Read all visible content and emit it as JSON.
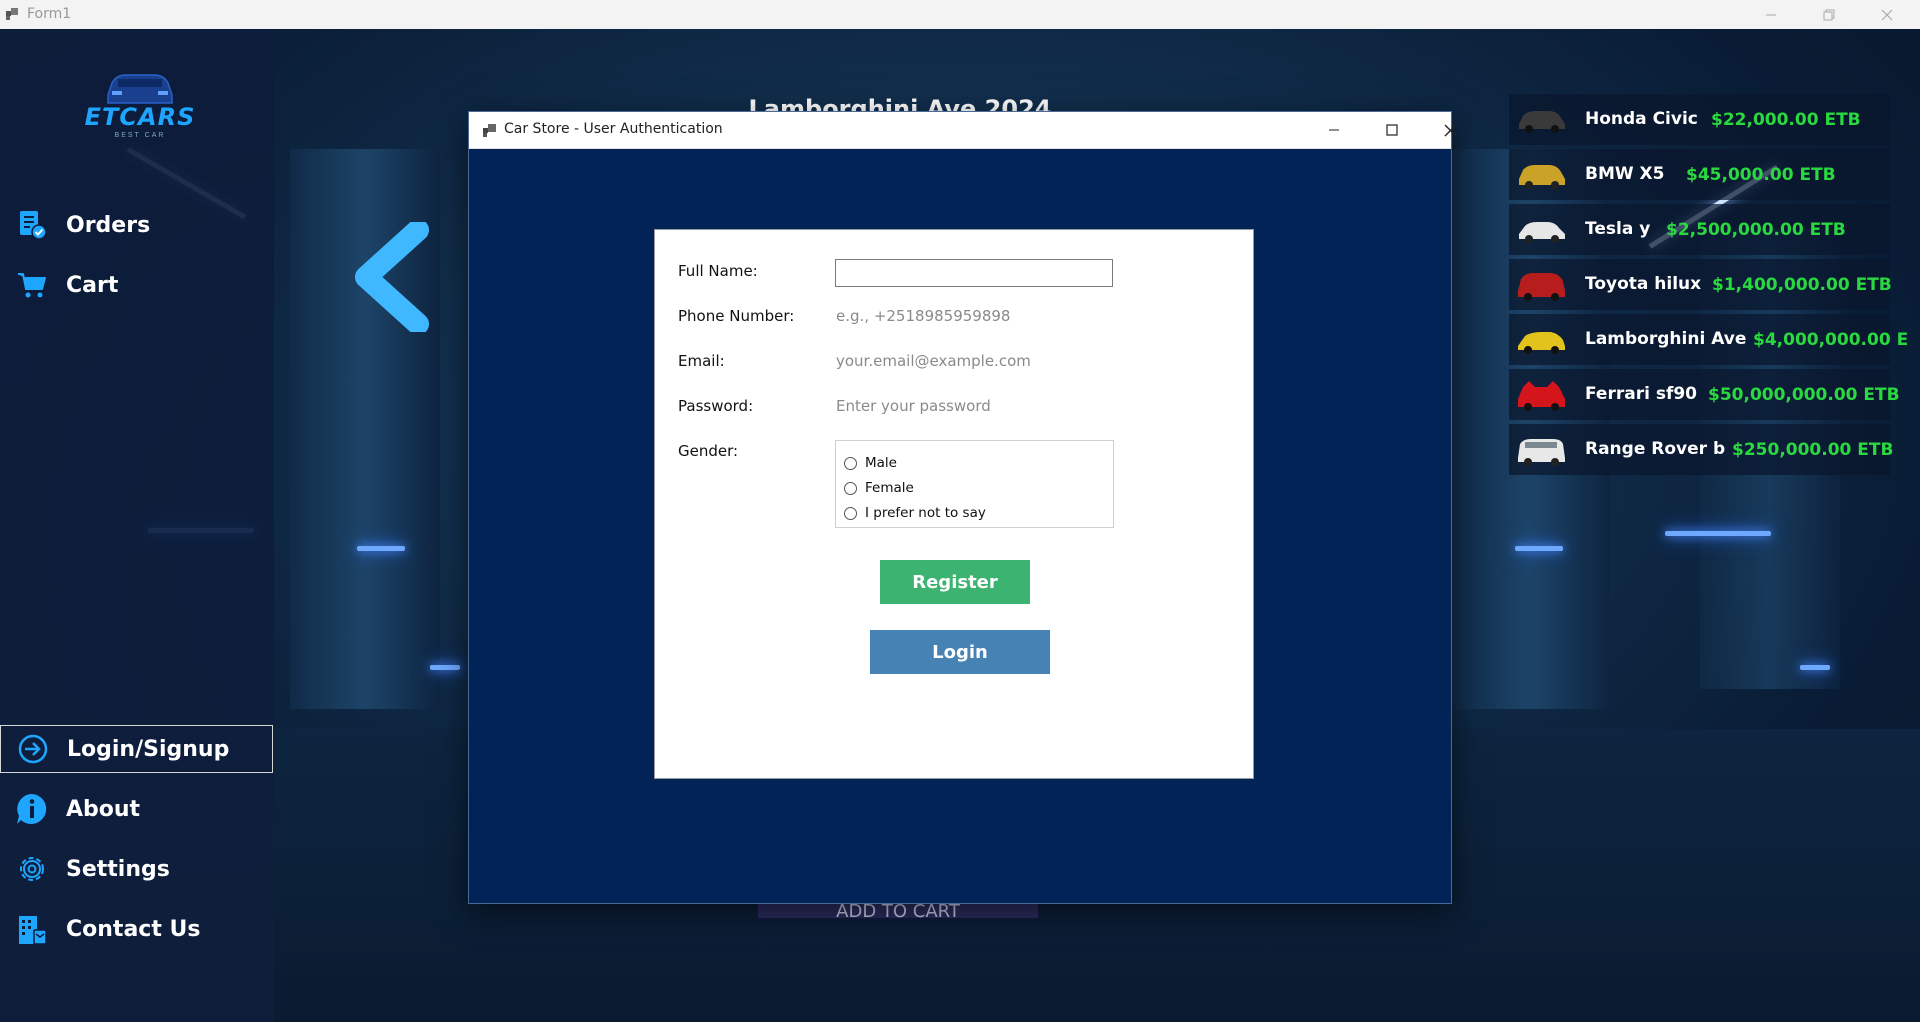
{
  "window": {
    "title": "Form1"
  },
  "sidebar": {
    "logo_text": "ETCARS",
    "logo_subtext": "BEST CAR",
    "top_items": [
      {
        "label": "Orders",
        "icon": "orders-icon"
      },
      {
        "label": "Cart",
        "icon": "cart-icon"
      }
    ],
    "bottom_items": [
      {
        "label": "Login/Signup",
        "icon": "login-icon",
        "active": true
      },
      {
        "label": "About",
        "icon": "info-icon"
      },
      {
        "label": "Settings",
        "icon": "gear-icon"
      },
      {
        "label": "Contact Us",
        "icon": "building-icon"
      }
    ]
  },
  "featured": {
    "title": "Lamborghini Ave 2024",
    "add_to_cart_label": "ADD TO CART"
  },
  "car_list": [
    {
      "name": "Honda Civic",
      "price": "$22,000.00 ETB",
      "color": "#3a3a3a"
    },
    {
      "name": "BMW X5",
      "price": "$45,000.00 ETB",
      "color": "#c9a227"
    },
    {
      "name": "Tesla y",
      "price": "$2,500,000.00 ETB",
      "color": "#e6e6e6"
    },
    {
      "name": "Toyota hilux",
      "price": "$1,400,000.00 ETB",
      "color": "#b81d1d"
    },
    {
      "name": "Lamborghini Ave",
      "price": "$4,000,000.00 E",
      "color": "#e2c21c"
    },
    {
      "name": "Ferrari sf90",
      "price": "$50,000,000.00 ETB",
      "color": "#d4161c"
    },
    {
      "name": "Range Rover b",
      "price": "$250,000.00 ETB",
      "color": "#e8e8e8"
    }
  ],
  "dialog": {
    "title": "Car Store - User Authentication",
    "fields": {
      "full_name": {
        "label": "Full Name:",
        "value": ""
      },
      "phone": {
        "label": "Phone Number:",
        "placeholder": "e.g., +2518985959898"
      },
      "email": {
        "label": "Email:",
        "placeholder": "your.email@example.com"
      },
      "password": {
        "label": "Password:",
        "placeholder": "Enter your password"
      },
      "gender": {
        "label": "Gender:",
        "options": [
          "Male",
          "Female",
          "I prefer not to say"
        ]
      }
    },
    "register_label": "Register",
    "login_label": "Login"
  },
  "colors": {
    "dialog_bg": "#022358",
    "register_btn": "#3cb371",
    "login_btn": "#4682b4",
    "price_green": "#29d93f",
    "logo_blue": "#1ea6ff"
  }
}
